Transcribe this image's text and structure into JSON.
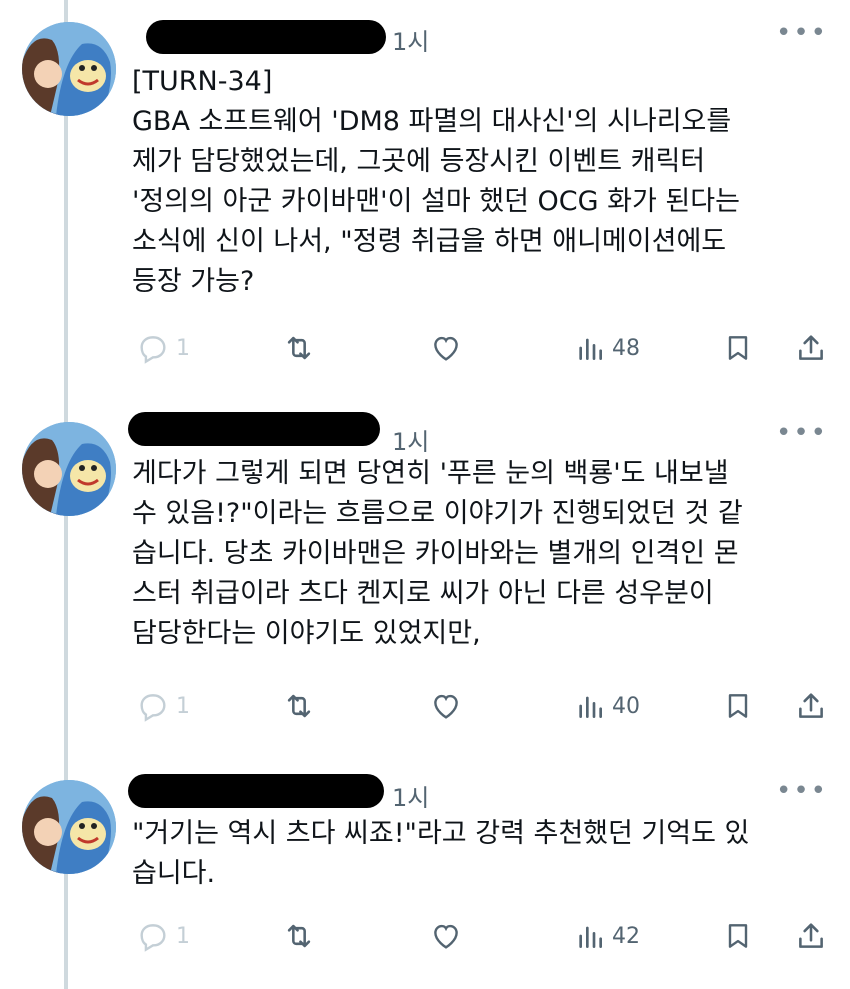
{
  "tweets": [
    {
      "time": "1시",
      "lines": [
        "[TURN-34]",
        "GBA 소프트웨어 'DM8 파멸의 대사신'의 시나리오를",
        "제가 담당했었는데, 그곳에 등장시킨 이벤트 캐릭터",
        "'정의의 아군 카이바맨'이 설마 했던 OCG 화가 된다는",
        "소식에 신이 나서, \"정령 취급을 하면 애니메이션에도",
        "등장 가능?"
      ],
      "replies": "1",
      "views": "48"
    },
    {
      "time": "1시",
      "lines": [
        "게다가 그렇게 되면 당연히 '푸른 눈의 백룡'도 내보낼",
        "수 있음!?\"이라는 흐름으로 이야기가 진행되었던 것 같",
        "습니다. 당초 카이바맨은 카이바와는 별개의 인격인 몬",
        "스터 취급이라 츠다 켄지로 씨가 아닌 다른 성우분이",
        "담당한다는 이야기도 있었지만,"
      ],
      "replies": "1",
      "views": "40"
    },
    {
      "time": "1시",
      "lines": [
        "\"거기는 역시 츠다 씨죠!\"라고 강력 추천했던 기억도 있",
        "습니다."
      ],
      "replies": "1",
      "views": "42"
    }
  ],
  "icons": {
    "reply": "reply-icon",
    "retweet": "retweet-icon",
    "like": "heart-icon",
    "views": "views-icon",
    "bookmark": "bookmark-icon",
    "share": "share-icon",
    "more": "more-icon"
  },
  "colors": {
    "thread_line": "#cfd9de",
    "muted": "#536471",
    "redaction": "#000000"
  }
}
